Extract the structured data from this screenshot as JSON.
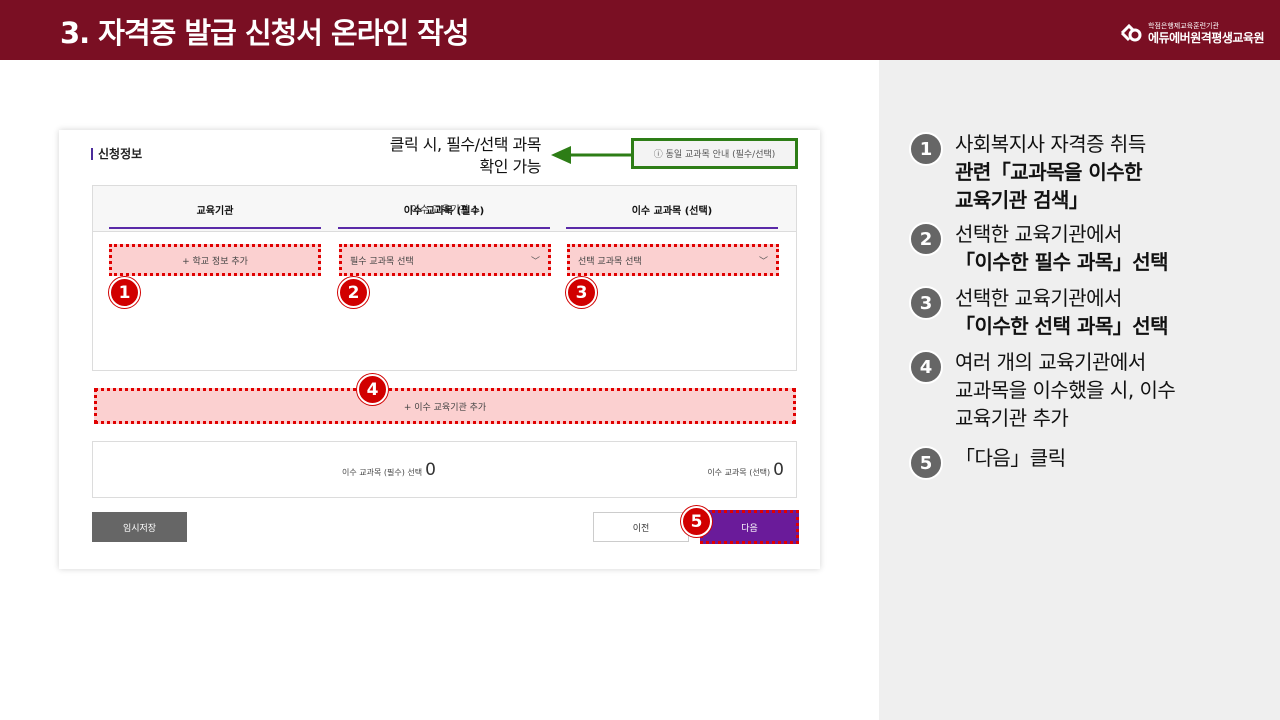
{
  "header": {
    "title": "3. 자격증 발급 신청서 온라인 작성",
    "logo_sub": "학점은행제교육훈련기관",
    "logo_main": "에듀에버원격평생교육원"
  },
  "form": {
    "section_title": "신청정보",
    "callout_line1": "클릭 시, 필수/선택 과목",
    "callout_line2": "확인 가능",
    "guide_button": "ⓘ 동일 교과목 안내 (필수/선택)",
    "institution_header": "이수 교육기관 1",
    "columns": [
      {
        "label": "교육기관",
        "field": "+ 학교 정보 추가"
      },
      {
        "label": "이수 교과목 (필수)",
        "field": "필수 교과목 선택"
      },
      {
        "label": "이수 교과목 (선택)",
        "field": "선택 교과목 선택"
      }
    ],
    "add_institution": "+ 이수 교육기관 추가",
    "required_selected_label": "이수 교과목 (필수) 선택",
    "required_selected_count": "0",
    "optional_selected_label": "이수 교과목 (선택)",
    "optional_selected_count": "0",
    "temp_save": "임시저장",
    "prev": "이전",
    "next": "다음"
  },
  "badges": [
    "1",
    "2",
    "3",
    "4",
    "5"
  ],
  "steps": [
    {
      "num": "1",
      "lines": [
        "사회복지사 자격증 취득",
        "관련「교과목을 이수한",
        "교육기관 검색」"
      ]
    },
    {
      "num": "2",
      "lines": [
        "선택한 교육기관에서",
        "「이수한 필수 과목」선택"
      ]
    },
    {
      "num": "3",
      "lines": [
        "선택한 교육기관에서",
        "「이수한 선택 과목」선택"
      ]
    },
    {
      "num": "4",
      "lines": [
        "여러 개의 교육기관에서",
        "교과목을 이수했을 시, 이수",
        "교육기관 추가"
      ]
    },
    {
      "num": "5",
      "lines": [
        "「다음」클릭"
      ]
    }
  ],
  "colors": {
    "header_bg": "#7a0f23",
    "accent_purple": "#6a1b9a",
    "highlight_red": "#e00000",
    "arrow_green": "#2d7d16"
  }
}
